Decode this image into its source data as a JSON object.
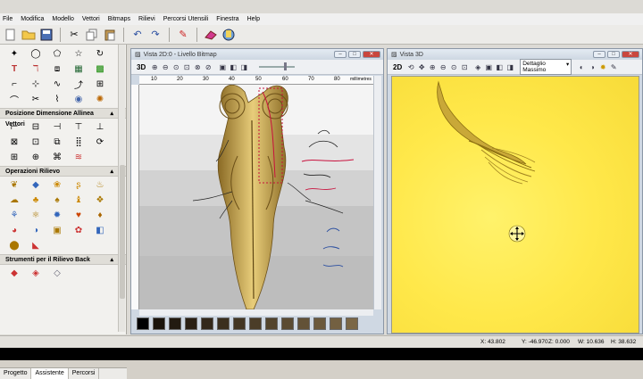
{
  "menu": [
    "File",
    "Modifica",
    "Modello",
    "Vettori",
    "Bitmaps",
    "Rilievi",
    "Percorsi Utensili",
    "Finestra",
    "Help"
  ],
  "left_panel": {
    "section_positions": "Posizione Dimensione Allinea Vettori",
    "section_relief": "Operazioni Rilievo",
    "section_relief_tools": "Strumenti per il Rilievo Back",
    "tabs": [
      "Progetto",
      "Assistente",
      "Percorsi"
    ],
    "active_tab": "Assistente"
  },
  "view2d": {
    "title": "Vista 2D:0 - Livello Bitmap",
    "toggle_label": "3D",
    "ruler_ticks": [
      "10",
      "20",
      "30",
      "40",
      "50",
      "60",
      "70",
      "80"
    ],
    "units": "millimetres"
  },
  "view3d": {
    "title": "Vista 3D",
    "toggle_label": "2D",
    "detail_value": "Dettaglio Massimo"
  },
  "status": {
    "x": "X: 43.802",
    "y": "Y: -46.970",
    "z": "Z: 0.000",
    "w": "W: 10.636",
    "h": "H: 38.632"
  },
  "colors": {
    "relief_yellow": "#ffe84a",
    "wood": "#c9a24a",
    "vector_red": "#c8103c"
  }
}
